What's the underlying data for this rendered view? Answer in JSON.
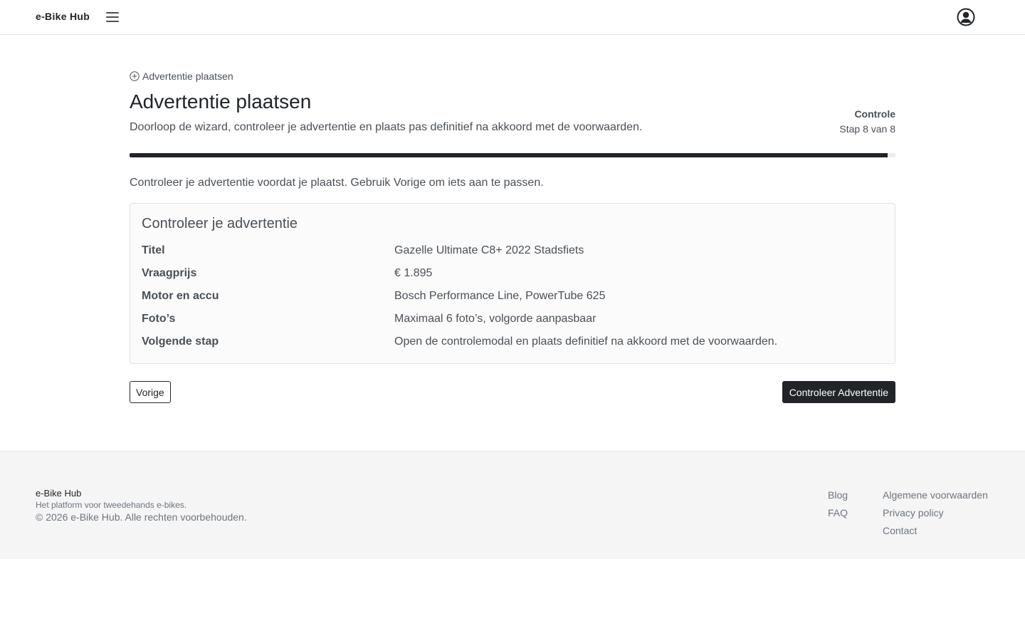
{
  "nav": {
    "brand": "e-Bike Hub",
    "menu_icon": "hamburger-icon",
    "user_icon": "user-circle-icon"
  },
  "header": {
    "eyebrow": "Advertentie plaatsen",
    "eyebrow_icon": "plus-circle-icon",
    "title": "Advertentie plaatsen",
    "subtitle": "Doorloop de wizard, controleer je advertentie en plaats pas definitief na akkoord met de voorwaarden.",
    "step_name": "Controle",
    "step_count": "Stap 8 van 8",
    "progress_percent": 99
  },
  "review": {
    "intro": "Controleer je advertentie voordat je plaatst. Gebruik Vorige om iets aan te passen.",
    "card_title": "Controleer je advertentie",
    "rows": [
      {
        "label": "Titel",
        "value": "Gazelle Ultimate C8+ 2022 Stadsfiets"
      },
      {
        "label": "Vraagprijs",
        "value": "€ 1.895"
      },
      {
        "label": "Motor en accu",
        "value": "Bosch Performance Line, PowerTube 625"
      },
      {
        "label": "Foto’s",
        "value": "Maximaal 6 foto’s, volgorde aanpasbaar"
      },
      {
        "label": "Volgende stap",
        "value": "Open de controlemodal en plaats definitief na akkoord met de voorwaarden."
      }
    ]
  },
  "actions": {
    "prev_label": "Vorige",
    "next_label": "Controleer Advertentie"
  },
  "footer": {
    "brand": "e-Bike Hub",
    "tagline": "Het platform voor tweedehands e-bikes.",
    "copyright": "© 2026 e-Bike Hub. Alle rechten voorbehouden.",
    "col1": [
      "Blog",
      "FAQ"
    ],
    "col2": [
      "Algemene voorwaarden",
      "Privacy policy",
      "Contact"
    ]
  },
  "colors": {
    "primary_dark": "#212529",
    "muted": "#6c757d",
    "border": "#dee2e6"
  }
}
